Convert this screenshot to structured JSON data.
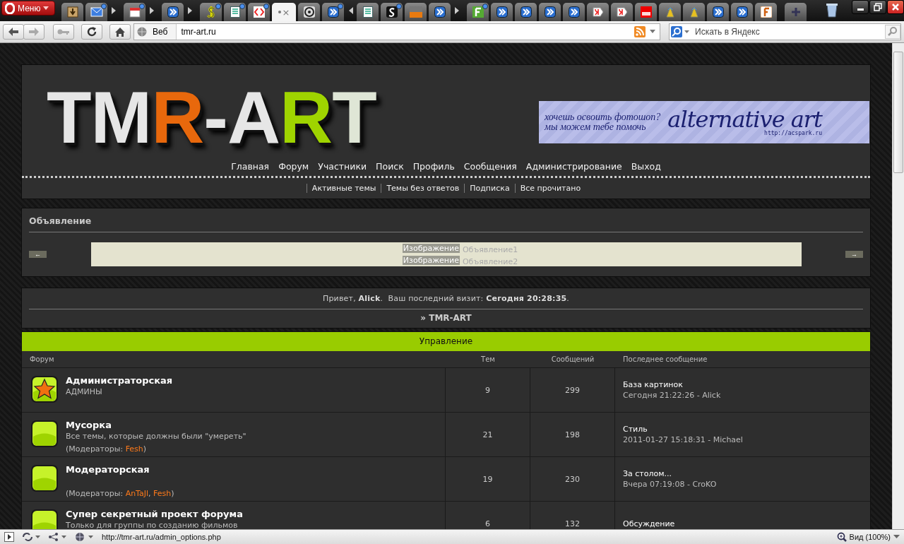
{
  "browser": {
    "menu_label": "Меню",
    "tabs": [
      {
        "kind": "download",
        "dot": false,
        "selected": false
      },
      {
        "kind": "mail",
        "dot": true,
        "selected": false
      },
      {
        "kind": "stack-right"
      },
      {
        "kind": "calendar",
        "dot": true,
        "selected": false
      },
      {
        "kind": "stack-right"
      },
      {
        "kind": "forward",
        "dot": false,
        "selected": false
      },
      {
        "kind": "stack-right"
      },
      {
        "kind": "dollar",
        "dot": true,
        "selected": false
      },
      {
        "kind": "page",
        "dot": true,
        "selected": false
      },
      {
        "kind": "code",
        "dot": true,
        "selected": false
      },
      {
        "kind": "blank",
        "dot": false,
        "selected": true,
        "close": "×"
      },
      {
        "kind": "disc",
        "dot": false,
        "selected": false
      },
      {
        "kind": "forward",
        "dot": true,
        "selected": false
      },
      {
        "kind": "stack-left"
      },
      {
        "kind": "page",
        "dot": false,
        "selected": false
      },
      {
        "kind": "s",
        "dot": true,
        "selected": false
      },
      {
        "kind": "web",
        "dot": false,
        "selected": false
      },
      {
        "kind": "forward",
        "dot": false,
        "selected": false
      },
      {
        "kind": "stack-right"
      },
      {
        "kind": "f-green",
        "dot": true,
        "selected": false
      },
      {
        "kind": "forward",
        "dot": false,
        "selected": false
      },
      {
        "kind": "forward",
        "dot": false,
        "selected": false
      },
      {
        "kind": "forward",
        "dot": false,
        "selected": false
      },
      {
        "kind": "forward",
        "dot": false,
        "selected": false
      },
      {
        "kind": "yandex",
        "dot": false,
        "selected": false
      },
      {
        "kind": "yandex",
        "dot": false,
        "selected": false
      },
      {
        "kind": "red",
        "dot": false,
        "selected": false
      },
      {
        "kind": "cone",
        "dot": false,
        "selected": false
      },
      {
        "kind": "cone",
        "dot": false,
        "selected": false
      },
      {
        "kind": "forward",
        "dot": false,
        "selected": false
      },
      {
        "kind": "forward",
        "dot": false,
        "selected": false
      },
      {
        "kind": "f-orange",
        "dot": false,
        "selected": false
      }
    ],
    "address_mode": "Веб",
    "address": "tmr-art.ru",
    "search_placeholder": "Искать в Яндекс",
    "status_url": "http://tmr-art.ru/admin_options.php",
    "zoom_label": "Вид (100%)"
  },
  "site": {
    "logo": [
      {
        "text": "TM",
        "color": "#e6e6e6"
      },
      {
        "text": "R",
        "color": "#e8680c"
      },
      {
        "text": "-A",
        "color": "#e6e6e6"
      },
      {
        "text": "R",
        "color": "#9fd400"
      },
      {
        "text": "T",
        "color": "#dfe6d6"
      }
    ],
    "banner": {
      "line1": "хочешь освоить фотошоп?",
      "line2": "мы можем тебе помочь",
      "brand": "alternative art",
      "url": "http://acspark.ru"
    },
    "nav": [
      "Главная",
      "Форум",
      "Участники",
      "Поиск",
      "Профиль",
      "Сообщения",
      "Администрирование",
      "Выход"
    ],
    "subnav": [
      "Активные темы",
      "Темы без ответов",
      "Подписка",
      "Все прочитано"
    ],
    "announcement": {
      "title": "Объявление",
      "prev": "←",
      "next": "→",
      "slides": [
        {
          "image_label": "Изображение",
          "text": "Объявление1"
        },
        {
          "image_label": "Изображение",
          "text": "Объявление2"
        }
      ]
    },
    "welcome": "Привет, **Alick**.  Ваш последний визит: **Сегодня 20:28:35**.",
    "breadcrumb": "» TMR-ART",
    "category": "Управление",
    "columns": [
      "Форум",
      "Тем",
      "Сообщений",
      "Последнее сообщение"
    ],
    "forums": [
      {
        "kind": "star",
        "title": "Администраторская",
        "description": "АДМИНЫ",
        "topics": "9",
        "posts": "299",
        "last_title": "База картинок",
        "last_meta": "Сегодня 21:22:26 - Alick"
      },
      {
        "kind": "plain",
        "title": "Мусорка",
        "description": "Все темы, которые должны были \"умереть\"",
        "moderators": [
          {
            "kind": "text",
            "text": "(Модераторы: "
          },
          {
            "kind": "link",
            "text": "Fesh"
          },
          {
            "kind": "text",
            "text": ")"
          }
        ],
        "topics": "21",
        "posts": "198",
        "last_title": "Стиль",
        "last_meta": "2011-01-27 15:18:31 - Michael"
      },
      {
        "kind": "plain",
        "title": "Модераторская",
        "moderators": [
          {
            "kind": "text",
            "text": "(Модераторы: "
          },
          {
            "kind": "link",
            "text": "AnTaJl"
          },
          {
            "kind": "text",
            "text": ", "
          },
          {
            "kind": "link",
            "text": "Fesh"
          },
          {
            "kind": "text",
            "text": ")"
          }
        ],
        "topics": "19",
        "posts": "230",
        "last_title": "За столом...",
        "last_meta": "Вчера 07:19:08 - CroKO"
      },
      {
        "kind": "plain",
        "title": "Супер секретный проект форума",
        "description": "Только для группы по созданию фильмов",
        "topics": "6",
        "posts": "132",
        "last_title": "Обсуждение"
      }
    ]
  }
}
